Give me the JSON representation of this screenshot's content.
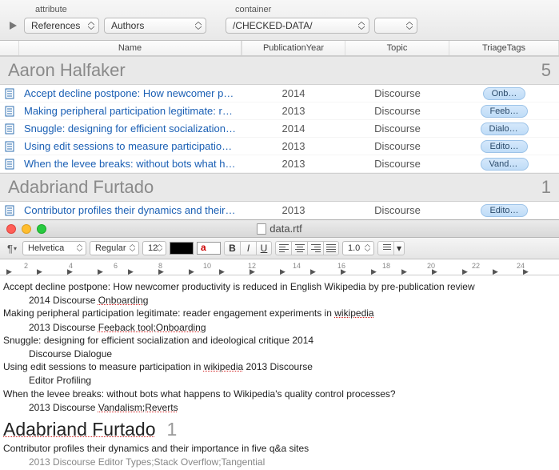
{
  "toolbar": {
    "label_attribute": "attribute",
    "label_container": "container",
    "dd_references": "References",
    "dd_authors": "Authors",
    "dd_path": "/CHECKED-DATA/",
    "dd_empty": ""
  },
  "columns": {
    "name": "Name",
    "year": "PublicationYear",
    "topic": "Topic",
    "tags": "TriageTags"
  },
  "groups": [
    {
      "name": "Aaron Halfaker",
      "count": "5",
      "rows": [
        {
          "title": "Accept decline postpone: How newcomer p…",
          "year": "2014",
          "topic": "Discourse",
          "tag": "Onb…"
        },
        {
          "title": "Making peripheral participation legitimate: r…",
          "year": "2013",
          "topic": "Discourse",
          "tag": "Feeb…"
        },
        {
          "title": "Snuggle: designing for efficient socialization…",
          "year": "2014",
          "topic": "Discourse",
          "tag": "Dialogue"
        },
        {
          "title": "Using edit sessions to measure participatio…",
          "year": "2013",
          "topic": "Discourse",
          "tag": "Edito…"
        },
        {
          "title": "When the levee breaks: without bots what h…",
          "year": "2013",
          "topic": "Discourse",
          "tag": "Vanda…"
        }
      ]
    },
    {
      "name": "Adabriand Furtado",
      "count": "1",
      "rows": [
        {
          "title": "Contributor profiles their dynamics and their…",
          "year": "2013",
          "topic": "Discourse",
          "tag": "Edito…"
        }
      ]
    }
  ],
  "editor": {
    "window_title": "data.rtf",
    "font": "Helvetica",
    "weight": "Regular",
    "size": "12",
    "spacing": "1.0",
    "ruler_numbers": [
      "2",
      "4",
      "6",
      "8",
      "10",
      "12",
      "14",
      "16",
      "18",
      "20",
      "22",
      "24"
    ],
    "body": {
      "e1_title": "Accept decline postpone: How newcomer productivity is reduced in English Wikipedia by pre-publication review",
      "e1_meta_year": "2014",
      "e1_meta_topic": "Discourse",
      "e1_meta_tag": "Onboarding",
      "e2_title_a": "Making peripheral participation legitimate: reader engagement experiments in ",
      "e2_title_b": "wikipedia",
      "e2_meta_year": "2013",
      "e2_meta_topic": "Discourse",
      "e2_meta_tag": "Feeback tool;Onboarding",
      "e3_title": "Snuggle: designing for efficient socialization and ideological critique 2014",
      "e3_meta": "Discourse Dialogue",
      "e4_title_a": "Using edit sessions to measure participation in ",
      "e4_title_b": "wikipedia",
      "e4_title_c": "2013",
      "e4_title_d": "Discourse",
      "e4_meta": "Editor Profiling",
      "e5_title": "When the levee breaks: without bots what happens to Wikipedia's quality control processes?",
      "e5_meta_year": "2013",
      "e5_meta_topic": "Discourse",
      "e5_meta_tag": "Vandalism;Reverts",
      "heading_name": "Adabriand Furtado",
      "heading_count": "1",
      "e6_title": "Contributor profiles their dynamics and their importance in five q&a sites",
      "e6_meta": "2013 Discourse Editor Types;Stack Overflow;Tangential"
    }
  }
}
